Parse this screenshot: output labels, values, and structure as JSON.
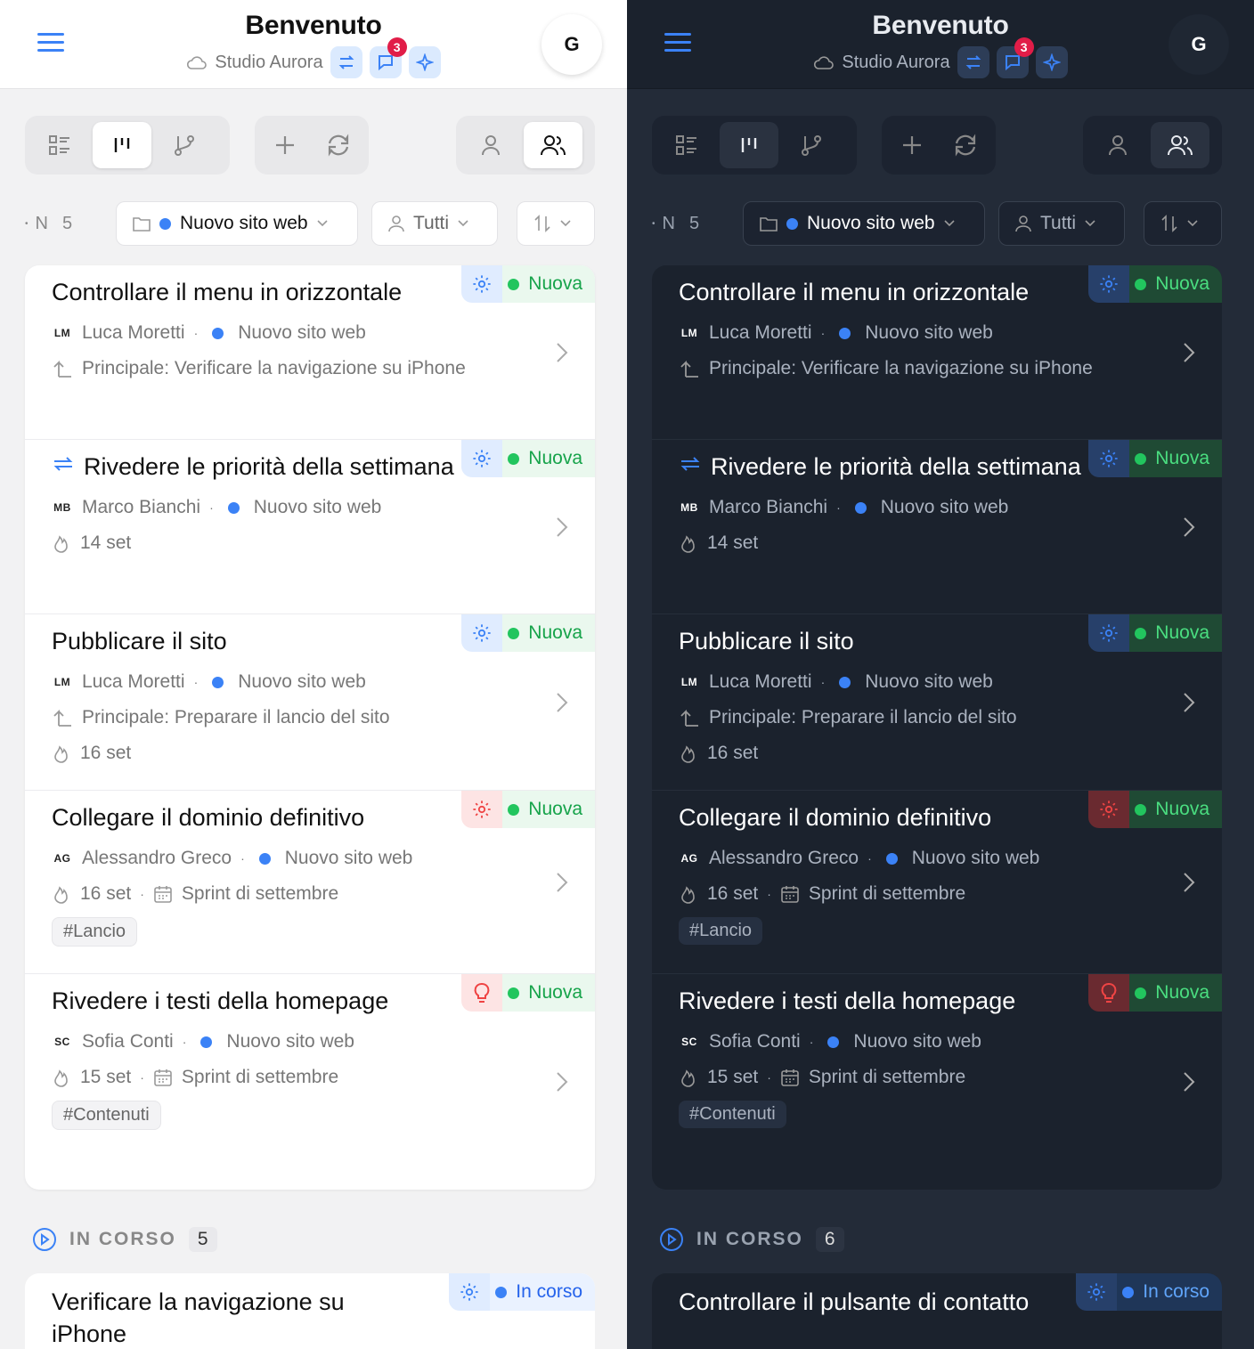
{
  "colors": {
    "accent": "#3b82f6",
    "green": "#22c55e",
    "red": "#e11d48"
  },
  "panes": [
    {
      "theme": "light",
      "header": {
        "title": "Benvenuto",
        "workspace": "Studio Aurora",
        "notifications": "3",
        "avatar": "G"
      },
      "filters": {
        "letter": "N",
        "count": "5",
        "project": "Nuovo sito web",
        "assignee": "Tutti"
      },
      "cards": [
        {
          "title": "Controllare il menu in orizzontale",
          "status": "Nuova",
          "icon": "gear-icon",
          "icon_color": "blue",
          "user_initials": "LM",
          "user": "Luca Moretti",
          "project": "Nuovo sito web",
          "parent": "Principale: Verificare la navigazione su iPhone"
        },
        {
          "title": "Rivedere le priorità della settimana",
          "status": "Nuova",
          "icon": "gear-icon",
          "icon_color": "blue",
          "recurring": true,
          "user_initials": "MB",
          "user": "Marco Bianchi",
          "project": "Nuovo sito web",
          "due": "14 set"
        },
        {
          "title": "Pubblicare il sito",
          "status": "Nuova",
          "icon": "gear-icon",
          "icon_color": "blue",
          "user_initials": "LM",
          "user": "Luca Moretti",
          "project": "Nuovo sito web",
          "parent": "Principale: Preparare il lancio del sito",
          "due": "16 set"
        },
        {
          "title": "Collegare il dominio definitivo",
          "status": "Nuova",
          "icon": "gear-icon",
          "icon_color": "red",
          "user_initials": "AG",
          "user": "Alessandro Greco",
          "project": "Nuovo sito web",
          "due": "16 set",
          "sprint": "Sprint di settembre",
          "tag": "#Lancio"
        },
        {
          "title": "Rivedere i testi della homepage",
          "status": "Nuova",
          "icon": "bulb-icon",
          "icon_color": "red",
          "user_initials": "SC",
          "user": "Sofia Conti",
          "project": "Nuovo sito web",
          "due": "15 set",
          "sprint": "Sprint di settembre",
          "tag": "#Contenuti"
        }
      ],
      "section": {
        "label": "IN CORSO",
        "count": "5"
      },
      "next_card": {
        "title": "Verificare la navigazione su iPhone",
        "status": "In corso"
      }
    },
    {
      "theme": "dark",
      "header": {
        "title": "Benvenuto",
        "workspace": "Studio Aurora",
        "notifications": "3",
        "avatar": "G"
      },
      "filters": {
        "letter": "N",
        "count": "5",
        "project": "Nuovo sito web",
        "assignee": "Tutti"
      },
      "cards": [
        {
          "title": "Controllare il menu in orizzontale",
          "status": "Nuova",
          "icon": "gear-icon",
          "icon_color": "blue",
          "user_initials": "LM",
          "user": "Luca Moretti",
          "project": "Nuovo sito web",
          "parent": "Principale: Verificare la navigazione su iPhone"
        },
        {
          "title": "Rivedere le priorità della settimana",
          "status": "Nuova",
          "icon": "gear-icon",
          "icon_color": "blue",
          "recurring": true,
          "user_initials": "MB",
          "user": "Marco Bianchi",
          "project": "Nuovo sito web",
          "due": "14 set"
        },
        {
          "title": "Pubblicare il sito",
          "status": "Nuova",
          "icon": "gear-icon",
          "icon_color": "blue",
          "user_initials": "LM",
          "user": "Luca Moretti",
          "project": "Nuovo sito web",
          "parent": "Principale: Preparare il lancio del sito",
          "due": "16 set"
        },
        {
          "title": "Collegare il dominio definitivo",
          "status": "Nuova",
          "icon": "gear-icon",
          "icon_color": "red",
          "user_initials": "AG",
          "user": "Alessandro Greco",
          "project": "Nuovo sito web",
          "due": "16 set",
          "sprint": "Sprint di settembre",
          "tag": "#Lancio"
        },
        {
          "title": "Rivedere i testi della homepage",
          "status": "Nuova",
          "icon": "bulb-icon",
          "icon_color": "red",
          "user_initials": "SC",
          "user": "Sofia Conti",
          "project": "Nuovo sito web",
          "due": "15 set",
          "sprint": "Sprint di settembre",
          "tag": "#Contenuti"
        }
      ],
      "section": {
        "label": "IN CORSO",
        "count": "6"
      },
      "next_card": {
        "title": "Controllare il pulsante di contatto",
        "status": "In corso"
      }
    }
  ]
}
